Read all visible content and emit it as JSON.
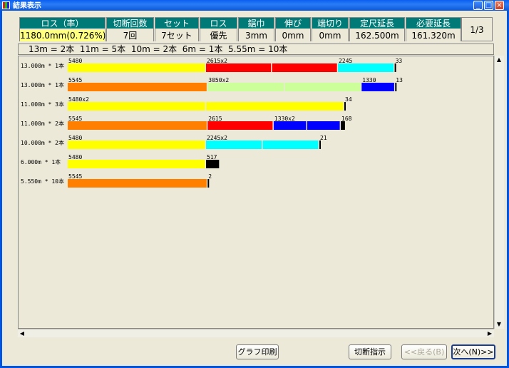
{
  "window": {
    "title": "結果表示"
  },
  "header": {
    "columns": [
      {
        "label": "ロス（率）",
        "value": "1180.0mm(0.726%)"
      },
      {
        "label": "切断回数",
        "value": "7回"
      },
      {
        "label": "セット",
        "value": "7セット"
      },
      {
        "label": "ロス",
        "value": "優先"
      },
      {
        "label": "鋸巾",
        "value": "3mm"
      },
      {
        "label": "伸び",
        "value": "0mm"
      },
      {
        "label": "端切り",
        "value": "0mm"
      },
      {
        "label": "定尺延長",
        "value": "162.500m"
      },
      {
        "label": "必要延長",
        "value": "161.320m"
      }
    ],
    "page": "1/3"
  },
  "summary": "13m = 2本  11m = 5本  10m = 2本  6m = 1本  5.55m = 10本",
  "rows": [
    {
      "label": "13.000m * 1本",
      "segments": [
        {
          "text": "5480",
          "width": 5480,
          "color": "#ffff00"
        },
        {
          "text": "2615x2",
          "width": 2615,
          "color": "#ff0000"
        },
        {
          "text": "",
          "width": 2615,
          "color": "#ff0000"
        },
        {
          "text": "2245",
          "width": 2245,
          "color": "#00ffff"
        },
        {
          "text": "33",
          "width": 33,
          "color": "#000000"
        }
      ]
    },
    {
      "label": "13.000m * 1本",
      "segments": [
        {
          "text": "5545",
          "width": 5545,
          "color": "#ff8000"
        },
        {
          "text": "3050x2",
          "width": 3050,
          "color": "#ccff99"
        },
        {
          "text": "",
          "width": 3050,
          "color": "#ccff99"
        },
        {
          "text": "1330",
          "width": 1330,
          "color": "#0000ff"
        },
        {
          "text": "13",
          "width": 13,
          "color": "#000000"
        }
      ]
    },
    {
      "label": "11.000m * 3本",
      "segments": [
        {
          "text": "5480x2",
          "width": 5480,
          "color": "#ffff00"
        },
        {
          "text": "",
          "width": 5480,
          "color": "#ffff00"
        },
        {
          "text": "34",
          "width": 34,
          "color": "#000000"
        }
      ]
    },
    {
      "label": "11.000m * 2本",
      "segments": [
        {
          "text": "5545",
          "width": 5545,
          "color": "#ff8000"
        },
        {
          "text": "2615",
          "width": 2615,
          "color": "#ff0000"
        },
        {
          "text": "1330x2",
          "width": 1330,
          "color": "#0000ff"
        },
        {
          "text": "",
          "width": 1330,
          "color": "#0000ff"
        },
        {
          "text": "168",
          "width": 168,
          "color": "#000000"
        }
      ]
    },
    {
      "label": "10.000m * 2本",
      "segments": [
        {
          "text": "5480",
          "width": 5480,
          "color": "#ffff00"
        },
        {
          "text": "2245x2",
          "width": 2245,
          "color": "#00ffff"
        },
        {
          "text": "",
          "width": 2245,
          "color": "#00ffff"
        },
        {
          "text": "21",
          "width": 21,
          "color": "#000000"
        }
      ]
    },
    {
      "label": "6.000m * 1本",
      "segments": [
        {
          "text": "5480",
          "width": 5480,
          "color": "#ffff00"
        },
        {
          "text": "517",
          "width": 517,
          "color": "#000000"
        }
      ]
    },
    {
      "label": "5.550m * 10本",
      "segments": [
        {
          "text": "5545",
          "width": 5545,
          "color": "#ff8000"
        },
        {
          "text": "2",
          "width": 2,
          "color": "#000000"
        }
      ]
    }
  ],
  "buttons": {
    "print": "グラフ印刷",
    "cut": "切断指示",
    "back": "<<戻る(B)",
    "next": "次へ(N)>>"
  }
}
